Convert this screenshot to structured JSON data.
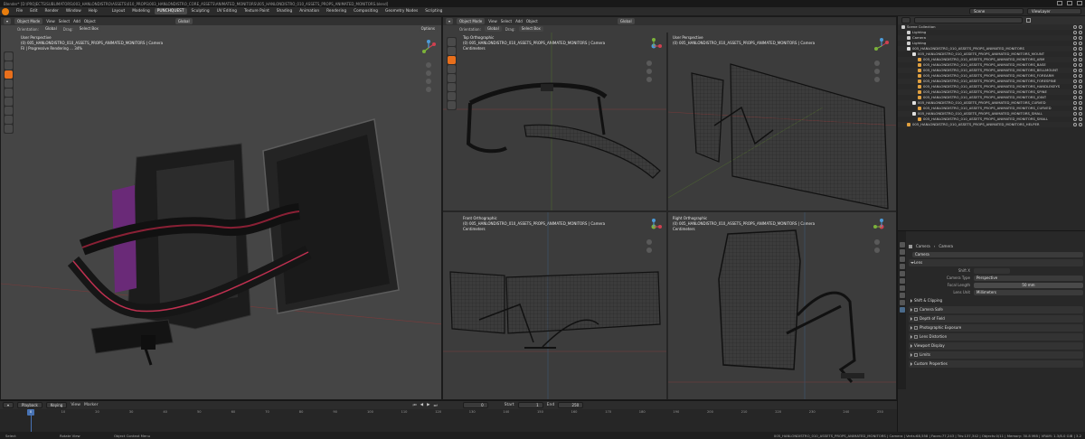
{
  "window": {
    "title": "Blender* [D:\\PROJECTS\\SUBLIMATORS\\003_HANLONDISTRO\\ASSETS\\010_PROPS\\003_HANLONDISTRO_CORE_ASSETS\\ANIMATED_MONITORS\\005_HANLONDISTRO_010_ASSETS_PROPS_ANIMATED_MONITORS.blend]"
  },
  "menu": {
    "items": [
      "File",
      "Edit",
      "Render",
      "Window",
      "Help"
    ],
    "workspaces": [
      "Layout",
      "Modeling",
      "PUNCHQUEST",
      "Sculpting",
      "UV Editing",
      "Texture Paint",
      "Shading",
      "Animation",
      "Rendering",
      "Compositing",
      "Geometry Nodes",
      "Scripting"
    ],
    "active_workspace": "PUNCHQUEST",
    "scene": "Scene",
    "view_layer": "ViewLayer"
  },
  "viewport_main": {
    "mode": "Object Mode",
    "menus": [
      "View",
      "Select",
      "Add",
      "Object"
    ],
    "orientation_label": "Orientation:",
    "orientation": "Global",
    "drag_label": "Drag:",
    "drag": "Select Box",
    "transform": "Global",
    "options": "Options",
    "info_lines": [
      "User Perspective",
      "(0) 005_HANLONDISTRO_010_ASSETS_PROPS_ANIMATED_MONITORS | Camera",
      "Fil | Progressive Rendering ... 34%"
    ]
  },
  "viewport_quad": {
    "mode": "Object Mode",
    "menus": [
      "View",
      "Select",
      "Add",
      "Object"
    ],
    "orientation_label": "Orientation:",
    "orientation": "Global",
    "drag_label": "Drag:",
    "drag": "Select Box",
    "transform": "Global",
    "options": "Options",
    "top_left": [
      "Top Orthographic",
      "(0) 005_HANLONDISTRO_010_ASSETS_PROPS_ANIMATED_MONITORS | Camera",
      "Centimeters"
    ],
    "top_right": [
      "User Perspective",
      "(0) 005_HANLONDISTRO_010_ASSETS_PROPS_ANIMATED_MONITORS | Camera"
    ],
    "bottom_left": [
      "Front Orthographic",
      "(0) 005_HANLONDISTRO_010_ASSETS_PROPS_ANIMATED_MONITORS | Camera",
      "Centimeters"
    ],
    "bottom_right": [
      "Right Orthographic",
      "(0) 005_HANLONDISTRO_010_ASSETS_PROPS_ANIMATED_MONITORS | Camera",
      "Centimeters"
    ]
  },
  "outliner": {
    "search_placeholder": "",
    "rows": [
      {
        "label": "Scene Collection",
        "depth": 0,
        "icon": "collection-icon",
        "color": "#cccccc"
      },
      {
        "label": "Lighting",
        "depth": 1,
        "icon": "collection-icon",
        "color": "#cccccc"
      },
      {
        "label": "Camera",
        "depth": 1,
        "icon": "camera-icon",
        "color": "#cccccc"
      },
      {
        "label": "Lighting",
        "depth": 1,
        "icon": "light-icon",
        "color": "#cccccc"
      },
      {
        "label": "005_HANLONDISTRO_010_ASSETS_PROPS_ANIMATED_MONITORS",
        "depth": 1,
        "icon": "collection-icon",
        "color": "#e0e0e0"
      },
      {
        "label": "005_HANLONDISTRO_010_ASSETS_PROPS_ANIMATED_MONITORS_MOUNT",
        "depth": 2,
        "icon": "collection-icon",
        "color": "#e0e0e0"
      },
      {
        "label": "005_HANLONDISTRO_010_ASSETS_PROPS_ANIMATED_MONITORS_ARM",
        "depth": 3,
        "icon": "mesh-icon",
        "color": "#e0a040"
      },
      {
        "label": "005_HANLONDISTRO_010_ASSETS_PROPS_ANIMATED_MONITORS_BASE",
        "depth": 3,
        "icon": "mesh-icon",
        "color": "#e0a040"
      },
      {
        "label": "005_HANLONDISTRO_010_ASSETS_PROPS_ANIMATED_MONITORS_BELLMOUNT",
        "depth": 3,
        "icon": "mesh-icon",
        "color": "#e0a040"
      },
      {
        "label": "005_HANLONDISTRO_010_ASSETS_PROPS_ANIMATED_MONITORS_FOREARM",
        "depth": 3,
        "icon": "mesh-icon",
        "color": "#e0a040"
      },
      {
        "label": "005_HANLONDISTRO_010_ASSETS_PROPS_ANIMATED_MONITORS_FORESPINE",
        "depth": 3,
        "icon": "mesh-icon",
        "color": "#e0a040"
      },
      {
        "label": "005_HANLONDISTRO_010_ASSETS_PROPS_ANIMATED_MONITORS_HANDLEKEYS",
        "depth": 3,
        "icon": "mesh-icon",
        "color": "#e0a040"
      },
      {
        "label": "005_HANLONDISTRO_010_ASSETS_PROPS_ANIMATED_MONITORS_SPINE",
        "depth": 3,
        "icon": "mesh-icon",
        "color": "#e0a040"
      },
      {
        "label": "005_HANLONDISTRO_010_ASSETS_PROPS_ANIMATED_MONITORS_JOINT",
        "depth": 3,
        "icon": "mesh-icon",
        "color": "#e0a040"
      },
      {
        "label": "005_HANLONDISTRO_010_ASSETS_PROPS_ANIMATED_MONITORS_CURVED",
        "depth": 2,
        "icon": "collection-icon",
        "color": "#e0e0e0"
      },
      {
        "label": "005_HANLONDISTRO_010_ASSETS_PROPS_ANIMATED_MONITORS_CURVED",
        "depth": 3,
        "icon": "mesh-icon",
        "color": "#e0a040"
      },
      {
        "label": "005_HANLONDISTRO_010_ASSETS_PROPS_ANIMATED_MONITORS_SMALL",
        "depth": 2,
        "icon": "collection-icon",
        "color": "#e0e0e0"
      },
      {
        "label": "005_HANLONDISTRO_010_ASSETS_PROPS_ANIMATED_MONITORS_SMALL",
        "depth": 3,
        "icon": "mesh-icon",
        "color": "#e0a040"
      },
      {
        "label": "005_HANLONDISTRO_010_ASSETS_PROPS_ANIMATED_MONITORS_HELPER",
        "depth": 1,
        "icon": "empty-icon",
        "color": "#e0a040"
      }
    ]
  },
  "properties": {
    "breadcrumb_object": "Camera",
    "breadcrumb_data": "Camera",
    "data_name": "Camera",
    "lens_section": "Lens",
    "camera_type_label": "Camera Type",
    "camera_type": "Perspective",
    "focal_length_label": "Focal Length",
    "focal_length": "50 mm",
    "lens_unit_label": "Lens Unit",
    "lens_unit": "Millimeters",
    "shift_label": "Shift X",
    "clip_section": "Shift & Clipping",
    "sections": [
      "Camera Safe",
      "Depth of Field",
      "Photographic Exposure",
      "Lens Distortion",
      "Viewport Display",
      "Limits",
      "Custom Properties"
    ]
  },
  "timeline": {
    "menus": [
      "Playback",
      "Keying",
      "View",
      "Marker"
    ],
    "current_frame": "0",
    "start_label": "Start",
    "start": "1",
    "end_label": "End",
    "end": "250",
    "ticks": [
      "0",
      "10",
      "20",
      "30",
      "40",
      "50",
      "60",
      "70",
      "80",
      "90",
      "100",
      "110",
      "120",
      "130",
      "140",
      "150",
      "160",
      "170",
      "180",
      "190",
      "200",
      "210",
      "220",
      "230",
      "240",
      "250"
    ]
  },
  "statusbar": {
    "items": [
      "Select",
      "Rotate View",
      "Object Context Menu"
    ],
    "stats": "005_HANLONDISTRO_010_ASSETS_PROPS_ANIMATED_MONITORS | Camera | Verts:68,558 | Faces:77,243 | Tris:137,342 | Objects:0/11 | Memory: 30.8 MiB | VRAM: 1.3/8.0 GiB | 3.2"
  },
  "colors": {
    "accent_orange": "#e87d0d",
    "selection_blue": "#4772b3",
    "monitor_red": "#c0304a"
  }
}
